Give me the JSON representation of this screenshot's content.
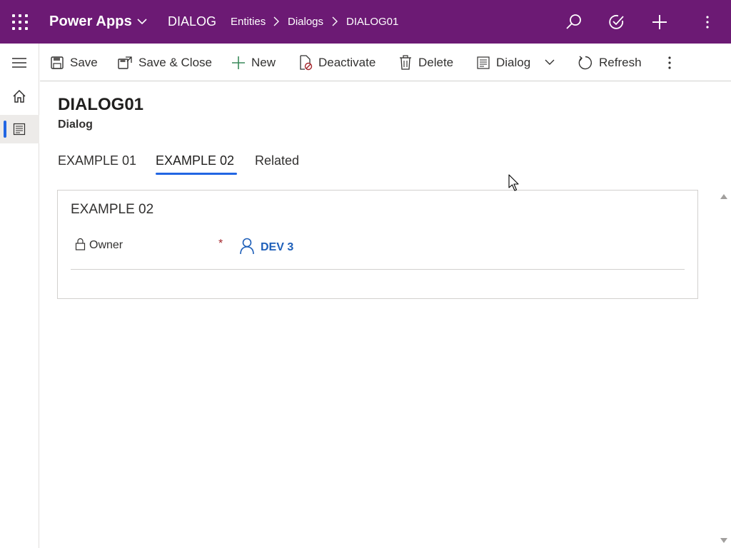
{
  "topbar": {
    "brand": "Power Apps",
    "app_name": "DIALOG",
    "breadcrumb": [
      "Entities",
      "Dialogs",
      "DIALOG01"
    ],
    "icons": [
      "waffle-icon",
      "chevron-down-icon",
      "search-icon",
      "task-check-icon",
      "plus-icon",
      "more-vertical-icon"
    ],
    "color": "#6c1a74"
  },
  "leftnav": {
    "icons": [
      "hamburger-icon",
      "home-icon",
      "entity-icon"
    ],
    "active_color": "#2266e3"
  },
  "command_bar": {
    "save": "Save",
    "save_close": "Save & Close",
    "new": "New",
    "deactivate": "Deactivate",
    "delete": "Delete",
    "dialog": "Dialog",
    "refresh": "Refresh"
  },
  "record": {
    "title": "DIALOG01",
    "entity": "Dialog"
  },
  "tabs": [
    {
      "label": "EXAMPLE 01",
      "selected": false
    },
    {
      "label": "EXAMPLE 02",
      "selected": true
    },
    {
      "label": "Related",
      "selected": false
    }
  ],
  "section": {
    "title": "EXAMPLE 02",
    "field": {
      "label": "Owner",
      "required_marker": "*",
      "value": "DEV 3"
    }
  },
  "colors": {
    "accent": "#2266e3",
    "link": "#1e5fb9",
    "required": "#a4262c"
  }
}
